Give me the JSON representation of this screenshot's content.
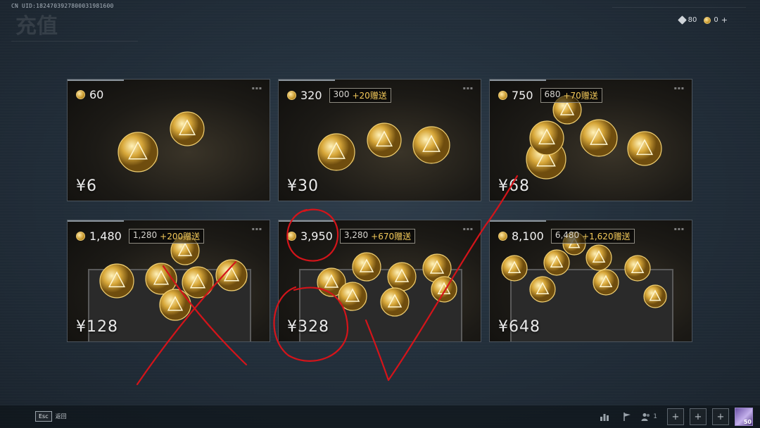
{
  "header": {
    "uid": "CN UID:1824703927800031981600",
    "title": "充值"
  },
  "currency": {
    "tickets": "80",
    "coins": "0",
    "add_label": "+"
  },
  "packages": [
    {
      "amount": "60",
      "bonus_base": "",
      "bonus_extra": "",
      "price": "¥6"
    },
    {
      "amount": "320",
      "bonus_base": "300",
      "bonus_extra": "+20赠送",
      "price": "¥30"
    },
    {
      "amount": "750",
      "bonus_base": "680",
      "bonus_extra": "+70赠送",
      "price": "¥68"
    },
    {
      "amount": "1,480",
      "bonus_base": "1,280",
      "bonus_extra": "+200赠送",
      "price": "¥128"
    },
    {
      "amount": "3,950",
      "bonus_base": "3,280",
      "bonus_extra": "+670赠送",
      "price": "¥328"
    },
    {
      "amount": "8,100",
      "bonus_base": "6,480",
      "bonus_extra": "+1,620赠送",
      "price": "¥648"
    }
  ],
  "footer": {
    "esc_key": "Esc",
    "back_label": "返回",
    "friends_count": "1",
    "slot_label": "+",
    "level": "50"
  },
  "colors": {
    "accent_gold": "#f3c95a",
    "annotation_red": "#d4141a"
  }
}
